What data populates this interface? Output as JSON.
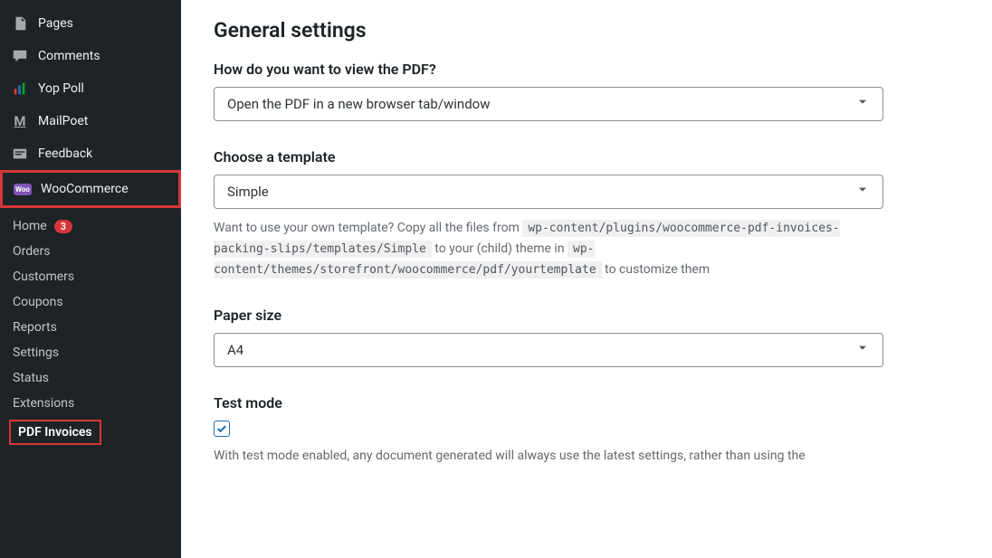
{
  "sidebar": {
    "top_items": [
      {
        "label": "Pages",
        "icon": "pages-icon"
      },
      {
        "label": "Comments",
        "icon": "comments-icon"
      },
      {
        "label": "Yop Poll",
        "icon": "poll-icon"
      },
      {
        "label": "MailPoet",
        "icon": "mailpoet-icon"
      },
      {
        "label": "Feedback",
        "icon": "feedback-icon"
      }
    ],
    "woo_label": "WooCommerce",
    "submenu": [
      {
        "label": "Home",
        "badge": "3"
      },
      {
        "label": "Orders"
      },
      {
        "label": "Customers"
      },
      {
        "label": "Coupons"
      },
      {
        "label": "Reports"
      },
      {
        "label": "Settings"
      },
      {
        "label": "Status"
      },
      {
        "label": "Extensions"
      }
    ],
    "pdf_invoices": "PDF Invoices"
  },
  "content": {
    "heading": "General settings",
    "view_pdf": {
      "label": "How do you want to view the PDF?",
      "value": "Open the PDF in a new browser tab/window"
    },
    "template": {
      "label": "Choose a template",
      "value": "Simple",
      "desc_pre": "Want to use your own template? Copy all the files from ",
      "path1": "wp-content/plugins/woocommerce-pdf-invoices-packing-slips/templates/Simple",
      "desc_mid": " to your (child) theme in ",
      "path2": "wp-content/themes/storefront/woocommerce/pdf/yourtemplate",
      "desc_post": " to customize them"
    },
    "paper": {
      "label": "Paper size",
      "value": "A4"
    },
    "test_mode": {
      "label": "Test mode",
      "checked": true,
      "desc": "With test mode enabled, any document generated will always use the latest settings, rather than using the"
    }
  }
}
